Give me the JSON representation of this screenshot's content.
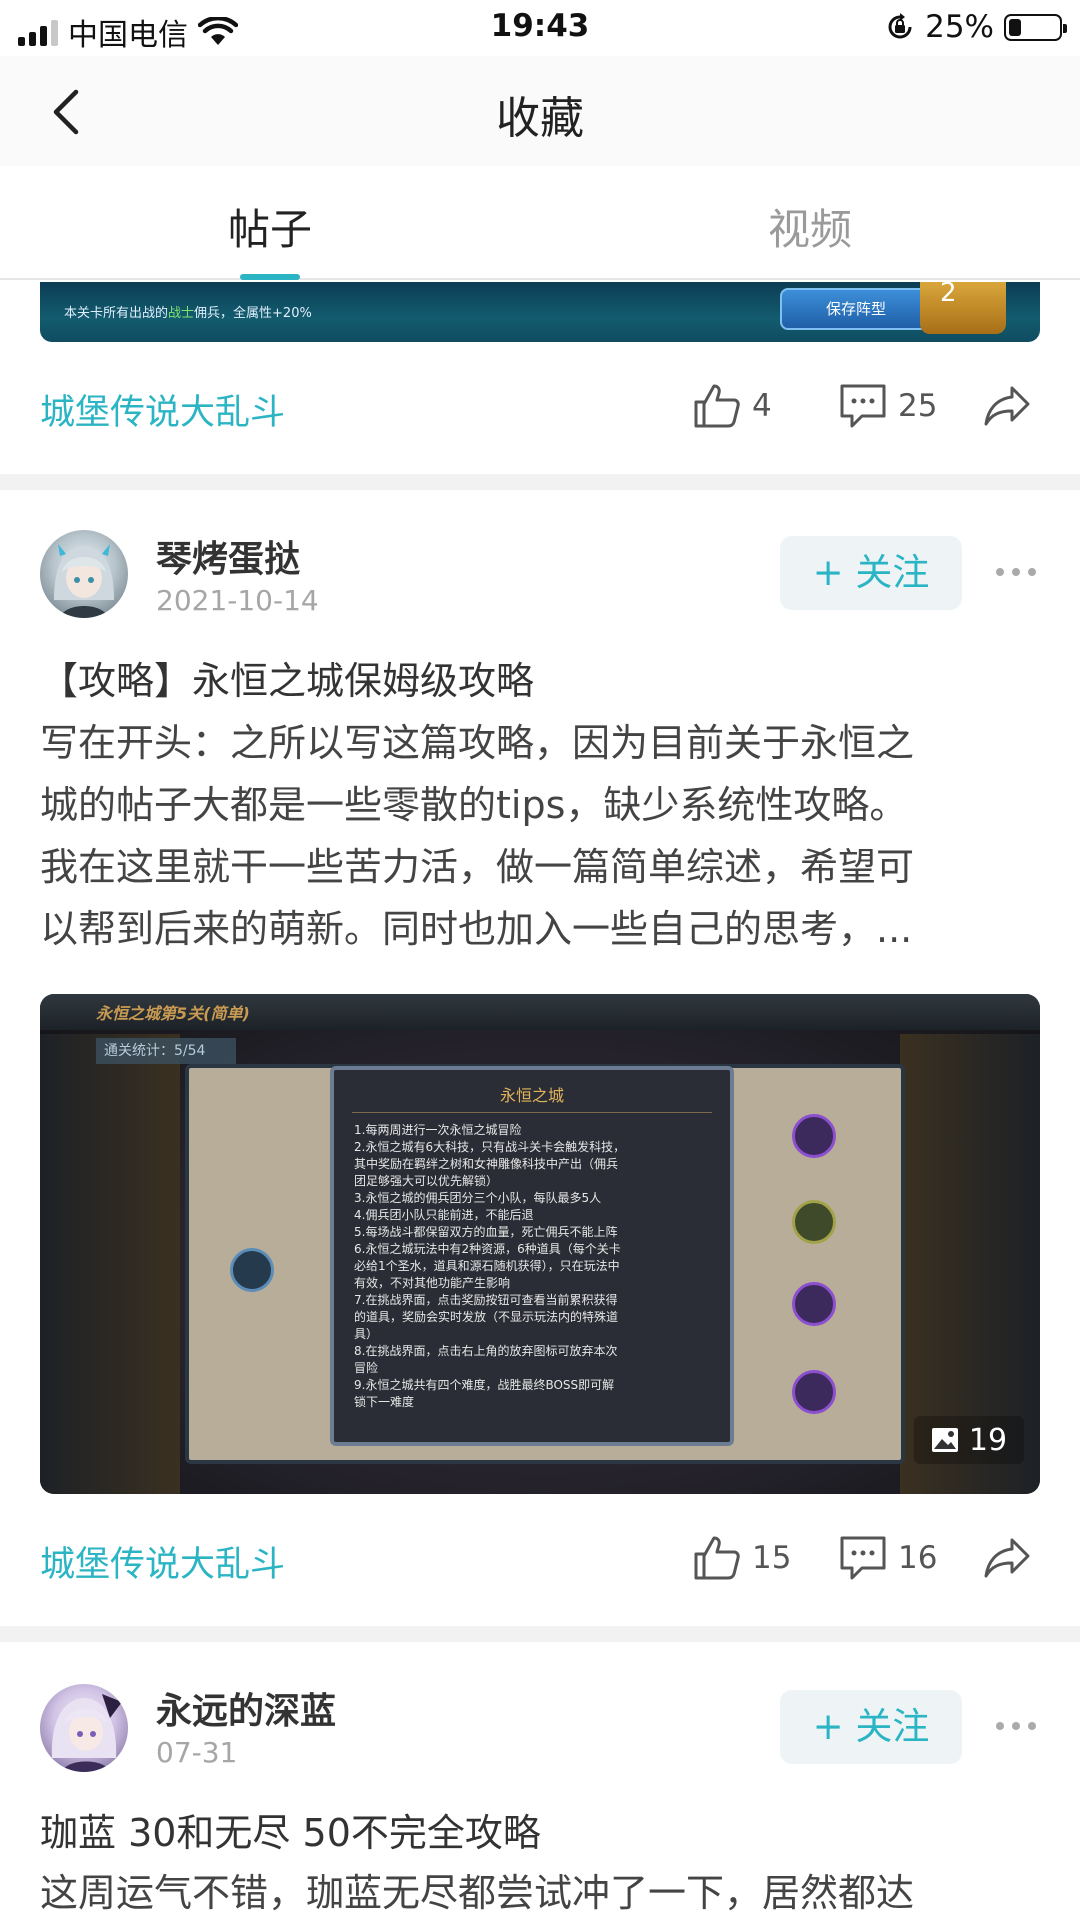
{
  "status_bar": {
    "carrier": "中国电信",
    "time": "19:43",
    "battery_percent": "25%",
    "battery_level": 0.25
  },
  "header": {
    "title": "收藏",
    "back_icon": "chevron-left-icon"
  },
  "tabs": [
    {
      "label": "帖子",
      "active": true
    },
    {
      "label": "视频",
      "active": false
    }
  ],
  "accent_color": "#2bb5c4",
  "partial_post": {
    "banner": {
      "text_prefix": "本关卡所有出战的",
      "text_highlight": "战士",
      "text_suffix": "佣兵，全属性+20%",
      "button": "保存阵型",
      "count": "2"
    },
    "game": "城堡传说大乱斗",
    "likes": "4",
    "comments": "25"
  },
  "posts": [
    {
      "author": "琴烤蛋挞",
      "date": "2021-10-14",
      "follow_label": "+ 关注",
      "title": "【攻略】永恒之城保姆级攻略",
      "body_lines": [
        "写在开头：之所以写这篇攻略，因为目前关于永恒之",
        "城的帖子大都是一些零散的tips，缺少系统性攻略。",
        "我在这里就干一些苦力活，做一篇简单综述，希望可",
        "以帮到后来的萌新。同时也加入一些自己的思考，..."
      ],
      "image": {
        "level_title": "永恒之城第5关(简单)",
        "stats": "通关统计：5/54",
        "dialog_title": "永恒之城",
        "dialog_lines": [
          "1.每两周进行一次永恒之城冒险",
          "2.永恒之城有6大科技，只有战斗关卡会触发科技，",
          "其中奖励在羁绊之树和女神雕像科技中产出（佣兵",
          "团足够强大可以优先解锁）",
          "3.永恒之城的佣兵团分三个小队，每队最多5人",
          "4.佣兵团小队只能前进，不能后退",
          "5.每场战斗都保留双方的血量，死亡佣兵不能上阵",
          "6.永恒之城玩法中有2种资源，6种道具（每个关卡",
          "必给1个圣水，道具和源石随机获得），只在玩法中",
          "有效，不对其他功能产生影响",
          "7.在挑战界面，点击奖励按钮可查看当前累积获得",
          "的道具，奖励会实时发放（不显示玩法内的特殊道",
          "具）",
          "8.在挑战界面，点击右上角的放弃图标可放弃本次",
          "冒险",
          "9.永恒之城共有四个难度，战胜最终BOSS即可解",
          "锁下一难度"
        ],
        "count": "19"
      },
      "game": "城堡传说大乱斗",
      "likes": "15",
      "comments": "16"
    },
    {
      "author": "永远的深蓝",
      "date": "07-31",
      "follow_label": "+ 关注",
      "title": "珈蓝 30和无尽 50不完全攻略",
      "body_lines": [
        "这周运气不错，珈蓝无尽都尝试冲了一下，居然都达"
      ]
    }
  ]
}
